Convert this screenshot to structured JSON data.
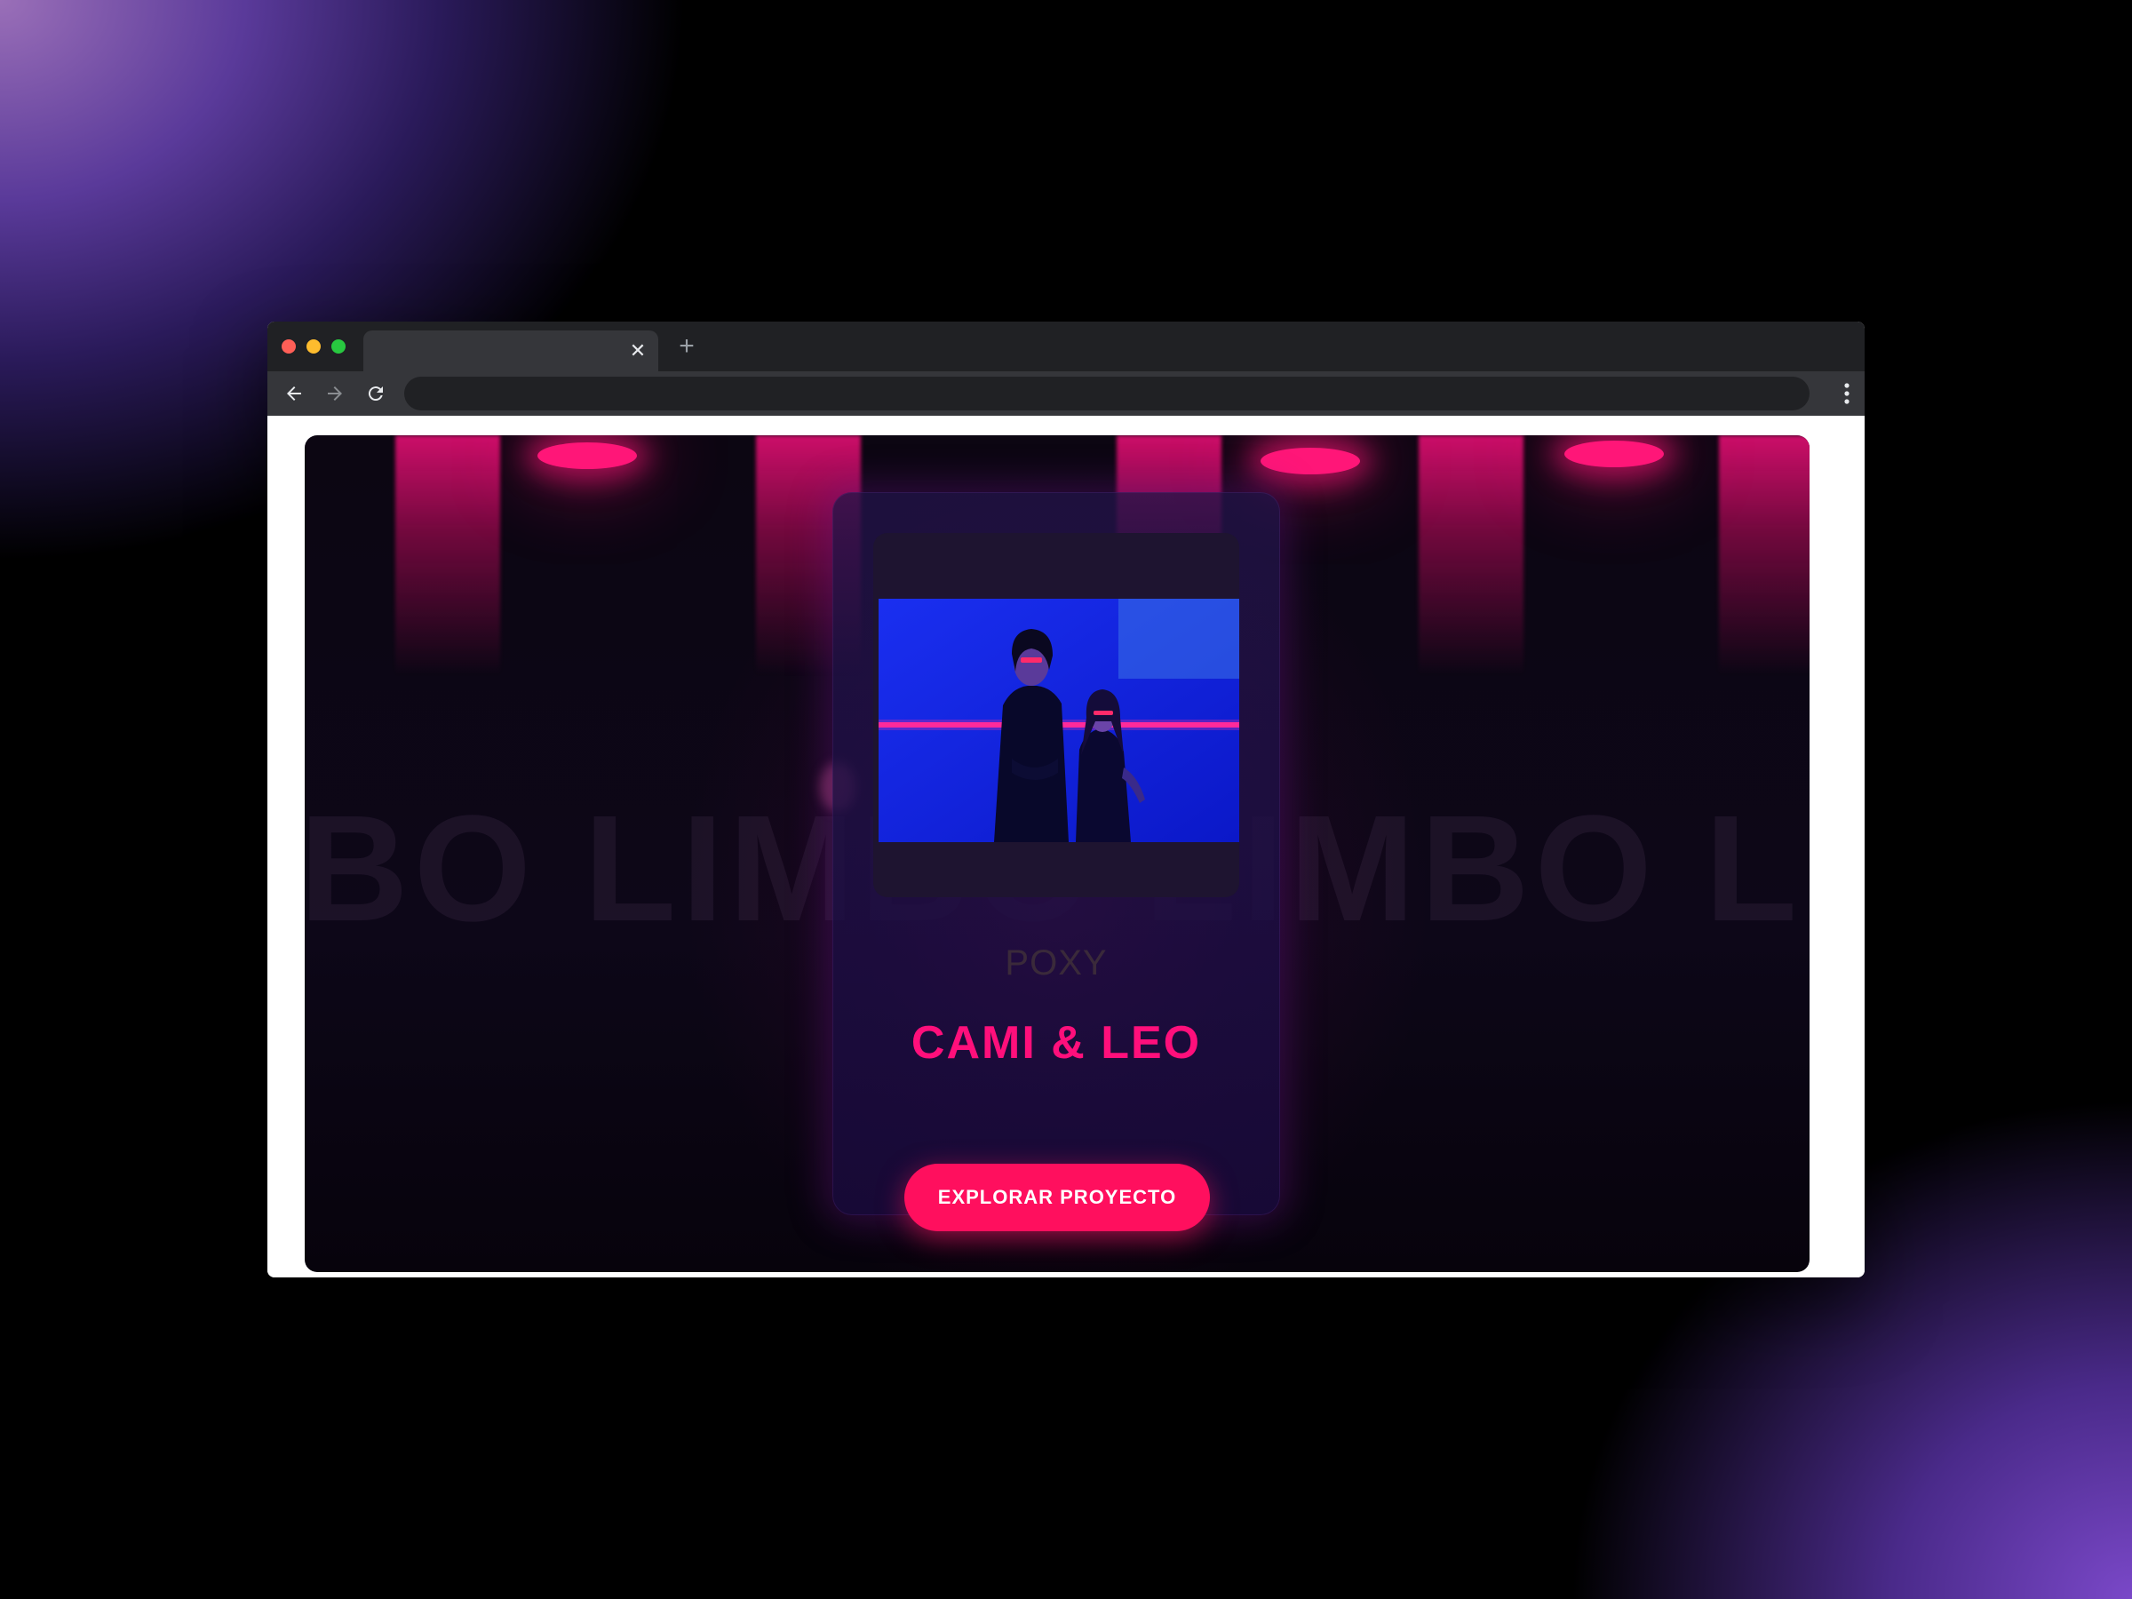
{
  "browser": {
    "tab_close": "✕",
    "new_tab": "+",
    "address": ""
  },
  "page": {
    "background_word": "BO LIMBO LIMBO LIMBO",
    "card": {
      "subtitle": "POXY",
      "title": "CAMI & LEO",
      "cta_label": "EXPLORAR PROYECTO"
    }
  },
  "colors": {
    "accent": "#ff0f7b",
    "button": "#ff0f5e",
    "beam": "#d70f6e"
  },
  "icons": [
    "back-arrow-icon",
    "forward-arrow-icon",
    "reload-icon",
    "more-vert-icon",
    "close-icon",
    "plus-icon"
  ]
}
